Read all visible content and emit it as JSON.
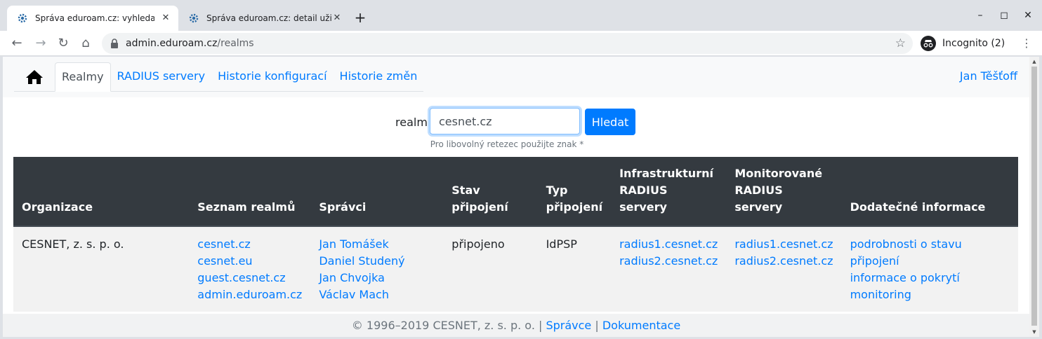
{
  "browser": {
    "tabs": [
      {
        "title": "Správa eduroam.cz: vyhledat",
        "active": true
      },
      {
        "title": "Správa eduroam.cz: detail uživ",
        "active": false
      }
    ],
    "new_tab": "+",
    "address": {
      "host": "admin.eduroam.cz",
      "path": "/realms"
    },
    "profile_label": "Incognito (2)"
  },
  "nav": {
    "home_icon": "house-icon",
    "tabs": [
      "Realmy",
      "RADIUS servery",
      "Historie konfigurací",
      "Historie změn"
    ],
    "active_tab": "Realmy",
    "user": "Jan Těšťoff"
  },
  "search": {
    "label": "realm",
    "value": "cesnet.cz",
    "button": "Hledat",
    "hint": "Pro libovolný retezec použijte znak *"
  },
  "table": {
    "headers": [
      "Organizace",
      "Seznam realmů",
      "Správci",
      "Stav připojení",
      "Typ připojení",
      "Infrastrukturní RADIUS servery",
      "Monitorované RADIUS servery",
      "Dodatečné informace"
    ],
    "row": {
      "organization": "CESNET, z. s. p. o.",
      "realms": [
        "cesnet.cz",
        "cesnet.eu",
        "guest.cesnet.cz",
        "admin.eduroam.cz"
      ],
      "admins": [
        "Jan Tomášek",
        "Daniel Studený",
        "Jan Chvojka",
        "Václav Mach"
      ],
      "status": "připojeno",
      "type": "IdPSP",
      "infra_servers": [
        "radius1.cesnet.cz",
        "radius2.cesnet.cz"
      ],
      "monitored_servers": [
        "radius1.cesnet.cz",
        "radius2.cesnet.cz"
      ],
      "info": [
        "podrobnosti o stavu připojení",
        "informace o pokrytí",
        "monitoring"
      ]
    }
  },
  "footer": {
    "copyright": "© 1996–2019 CESNET, z. s. p. o. |",
    "sep": "|",
    "admins_link": "Správce",
    "docs_link": "Dokumentace"
  },
  "colors": {
    "link": "#007bff",
    "table_header": "#343a40",
    "button": "#007bff"
  }
}
